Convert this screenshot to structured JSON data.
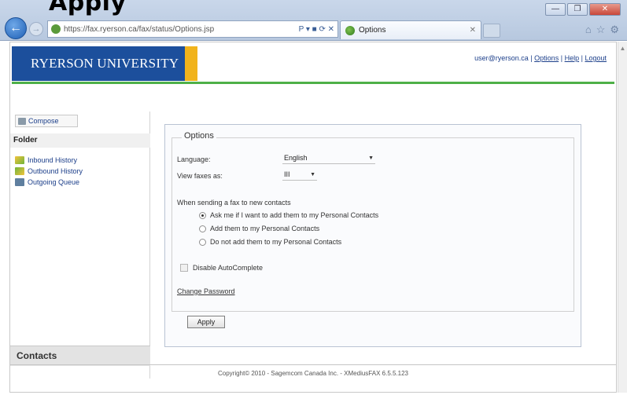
{
  "overlay": {
    "title": "Apply"
  },
  "browser": {
    "address": "https://fax.ryerson.ca/fax/status/Options.jsp",
    "address_icons": "P ▾ ■ ⟳ ✕",
    "tab_label": "Options",
    "window_controls": [
      "—",
      "❐",
      "✕"
    ]
  },
  "header": {
    "logo_text": "RYERSON UNIVERSITY",
    "user_email": "user@ryerson.ca",
    "links": [
      "Options",
      "Help",
      "Logout"
    ],
    "separator": "|"
  },
  "sidebar": {
    "compose_label": "Compose",
    "folder_heading": "Folder",
    "folders": [
      {
        "label": "Inbound History",
        "icon": "inbound-history-icon"
      },
      {
        "label": "Outbound History",
        "icon": "outbound-history-icon"
      },
      {
        "label": "Outgoing Queue",
        "icon": "outgoing-queue-icon"
      }
    ],
    "contacts_label": "Contacts"
  },
  "options": {
    "legend": "Options",
    "language_label": "Language:",
    "language_value": "English",
    "view_faxes_label": "View faxes as:",
    "view_faxes_value": "III",
    "contacts_prompt": "When sending a fax to new contacts",
    "radio_options": [
      {
        "label": "Ask me if I want to add them to my Personal Contacts",
        "selected": true
      },
      {
        "label": "Add them to my Personal Contacts",
        "selected": false
      },
      {
        "label": "Do not add them to my Personal Contacts",
        "selected": false
      }
    ],
    "autocomplete_label": "Disable AutoComplete",
    "change_password_label": "Change Password",
    "apply_label": "Apply"
  },
  "footer": {
    "copyright": "Copyright© 2010 - Sagemcom Canada Inc. - XMediusFAX 6.5.5.123"
  }
}
